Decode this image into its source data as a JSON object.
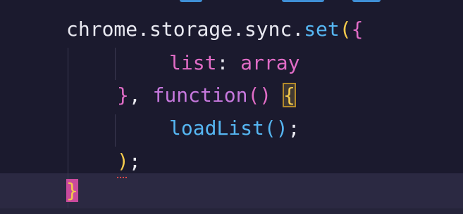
{
  "editor": {
    "lines": [
      {
        "tokens": [
          {
            "text": "chrome",
            "cls": "tok-ident"
          },
          {
            "text": ".",
            "cls": "tok-punct"
          },
          {
            "text": "storage",
            "cls": "tok-ident"
          },
          {
            "text": ".",
            "cls": "tok-punct"
          },
          {
            "text": "sync",
            "cls": "tok-ident"
          },
          {
            "text": ".",
            "cls": "tok-punct"
          },
          {
            "text": "set",
            "cls": "tok-method"
          },
          {
            "text": "(",
            "cls": "tok-bracket-gold"
          },
          {
            "text": "{",
            "cls": "tok-bracket-pink"
          }
        ]
      },
      {
        "tokens": [
          {
            "text": "list",
            "cls": "tok-prop"
          },
          {
            "text": ": ",
            "cls": "tok-punct"
          },
          {
            "text": "array",
            "cls": "tok-prop"
          }
        ]
      },
      {
        "tokens": [
          {
            "text": "}",
            "cls": "tok-bracket-pink"
          },
          {
            "text": ", ",
            "cls": "tok-punct"
          },
          {
            "text": "function",
            "cls": "tok-keyword"
          },
          {
            "text": "()",
            "cls": "tok-bracket-pink"
          },
          {
            "text": " ",
            "cls": "tok-punct"
          },
          {
            "text": "{",
            "cls": "tok-bracket-gold"
          }
        ]
      },
      {
        "tokens": [
          {
            "text": "loadList",
            "cls": "tok-method"
          },
          {
            "text": "()",
            "cls": "tok-bracket-blue"
          },
          {
            "text": ";",
            "cls": "tok-punct"
          }
        ]
      },
      {
        "tokens": [
          {
            "text": ")",
            "cls": "tok-bracket-gold"
          },
          {
            "text": ";",
            "cls": "tok-punct"
          }
        ]
      },
      {
        "tokens": [
          {
            "text": "}",
            "cls": "tok-bracket-gold"
          }
        ]
      }
    ],
    "colors": {
      "background": "#1b1a2e",
      "current_line": "#2b2942",
      "method": "#56b6f2",
      "keyword": "#c678dd",
      "property": "#e06cc6",
      "bracket_gold": "#f2c94c",
      "error_squiggle": "#e04a4a"
    }
  }
}
